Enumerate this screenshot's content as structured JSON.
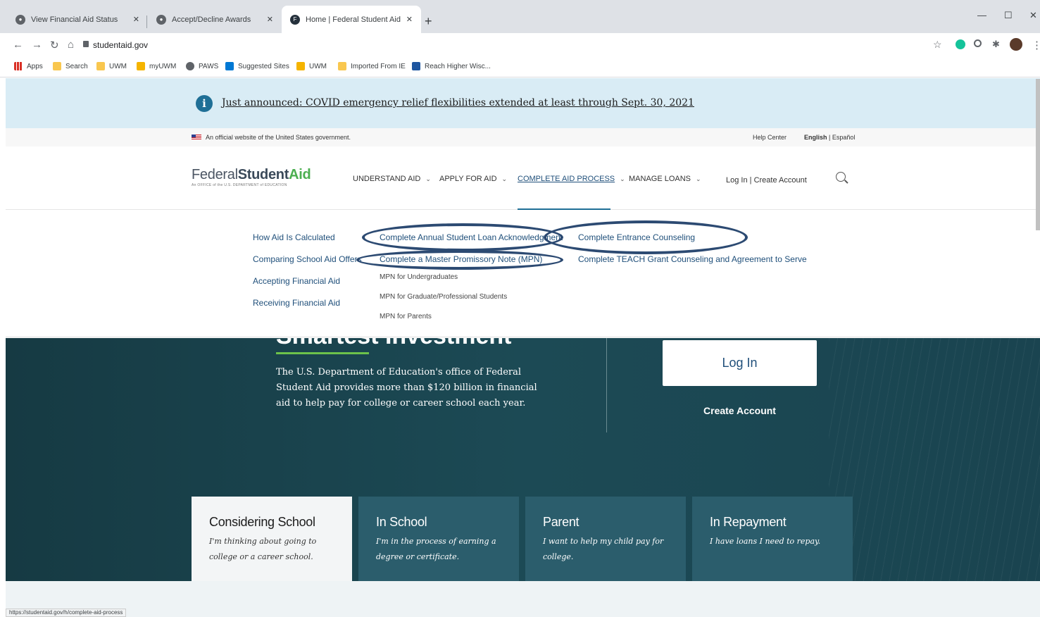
{
  "browser": {
    "tabs": [
      {
        "title": "View Financial Aid Status",
        "favicon": "globe-icon",
        "active": false
      },
      {
        "title": "Accept/Decline Awards",
        "favicon": "globe-icon",
        "active": false
      },
      {
        "title": "Home | Federal Student Aid",
        "favicon": "fsa-icon",
        "active": true
      }
    ],
    "url": "studentaid.gov",
    "bookmarks": [
      "Apps",
      "Search",
      "UWM",
      "myUWM",
      "PAWS",
      "Suggested Sites",
      "UWM",
      "Imported From IE",
      "Reach Higher Wisc..."
    ],
    "status_url": "https://studentaid.gov/h/complete-aid-process"
  },
  "alert": {
    "text": "Just announced: COVID emergency relief flexibilities extended at least through Sept. 30, 2021"
  },
  "govbar": {
    "official": "An official website of the United States government.",
    "help": "Help Center",
    "lang_en": "English",
    "lang_es": "Español"
  },
  "header": {
    "logo_part1": "Federal",
    "logo_part2": "Student",
    "logo_part3": "Aid",
    "logo_sub": "An OFFICE of the U.S. DEPARTMENT of EDUCATION",
    "nav": [
      "UNDERSTAND AID",
      "APPLY FOR AID",
      "COMPLETE AID PROCESS",
      "MANAGE LOANS"
    ],
    "login": "Log In",
    "create": "Create Account"
  },
  "dropdown": {
    "col1": [
      "How Aid Is Calculated",
      "Comparing School Aid Offers",
      "Accepting Financial Aid",
      "Receiving Financial Aid"
    ],
    "col2_link1": "Complete Annual Student Loan Acknowledgment",
    "col2_link2": "Complete a Master Promissory Note (MPN)",
    "col2_subs": [
      "MPN for Undergraduates",
      "MPN for Graduate/Professional Students",
      "MPN for Parents"
    ],
    "col3": [
      "Complete Entrance Counseling",
      "Complete TEACH Grant Counseling and Agreement to Serve"
    ]
  },
  "hero": {
    "title": "Smartest Investment",
    "text": "The U.S. Department of Education's office of Federal Student Aid provides more than $120 billion in financial aid to help pay for college or career school each year.",
    "login": "Log In",
    "create": "Create Account"
  },
  "cards": [
    {
      "title": "Considering School",
      "desc": "I'm thinking about going to college or a career school."
    },
    {
      "title": "In School",
      "desc": "I'm in the process of earning a degree or certificate."
    },
    {
      "title": "Parent",
      "desc": "I want to help my child pay for college."
    },
    {
      "title": "In Repayment",
      "desc": "I have loans I need to repay."
    }
  ],
  "colors": {
    "annotation": "#2c4a72",
    "hero": "#1c4a55",
    "accent_green": "#6cc24a"
  }
}
